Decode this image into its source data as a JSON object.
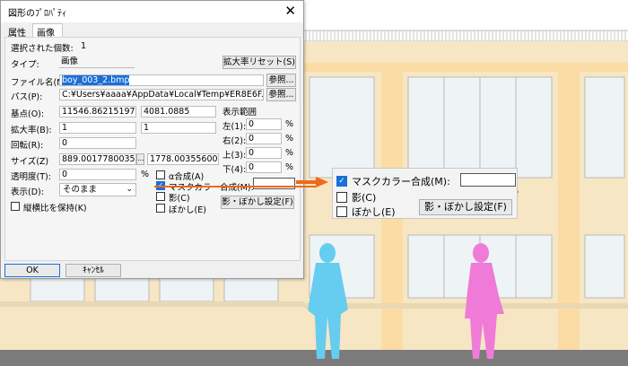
{
  "dialog": {
    "title": "図形のﾌﾟﾛﾊﾟﾃｨ",
    "close_icon": "close-icon",
    "tabs": [
      "属性",
      "画像"
    ],
    "selected_count_label": "選択された個数:",
    "selected_count": "1",
    "type_label": "タイプ:",
    "type_value": "画像",
    "reset_zoom_button": "拡大率リセット(S)",
    "filename_label": "ファイル名(N):",
    "filename_value": "boy_003_2.bmp",
    "browse_button": "参照...",
    "path_label": "パス(P):",
    "path_value": "C:¥Users¥aaaa¥AppData¥Local¥Temp¥ER8E6F.tmp¥",
    "browse_button_2": "参照...",
    "base_point_label": "基点(O):",
    "base_point_x": "11546.862151973",
    "base_point_y": "4081.0885",
    "scale_label": "拡大率(B):",
    "scale_x": "1",
    "scale_y": "1",
    "rotation_label": "回転(R):",
    "rotation_value": "0",
    "size_label": "サイズ(Z)",
    "size_x": "889.00177800356",
    "size_y": "1778.0035560071",
    "size_btn": "...",
    "opacity_label": "透明度(T):",
    "opacity_value": "0",
    "opacity_unit": "%",
    "display_label": "表示(D):",
    "display_value": "そのまま",
    "keep_aspect_label": "縦横比を保持(K)",
    "display_range_label": "表示範囲",
    "range": [
      {
        "label": "左(1):",
        "value": "0",
        "unit": "%"
      },
      {
        "label": "右(2):",
        "value": "0",
        "unit": "%"
      },
      {
        "label": "上(3):",
        "value": "0",
        "unit": "%"
      },
      {
        "label": "下(4):",
        "value": "0",
        "unit": "%"
      }
    ],
    "alpha_label": "α合成(A)",
    "mask_label": "マスクカラー合成(M):",
    "shadow_label": "影(C)",
    "blur_label": "ぼかし(E)",
    "shadow_blur_button": "影・ぼかし設定(F)",
    "ok_button": "OK",
    "cancel_button": "ｷｬﾝｾﾙ"
  },
  "callout": {
    "mask_label": "マスクカラー合成(M):",
    "shadow_label": "影(C)",
    "blur_label": "ぼかし(E)",
    "shadow_blur_button": "影・ぼかし設定(F)"
  },
  "colors": {
    "accent": "#1a6fd8",
    "arrow": "#ee6a17",
    "building": "#f6e6c4",
    "pillar": "#fbdca4",
    "boy": "#66ccf0",
    "girl": "#f07ad8"
  }
}
